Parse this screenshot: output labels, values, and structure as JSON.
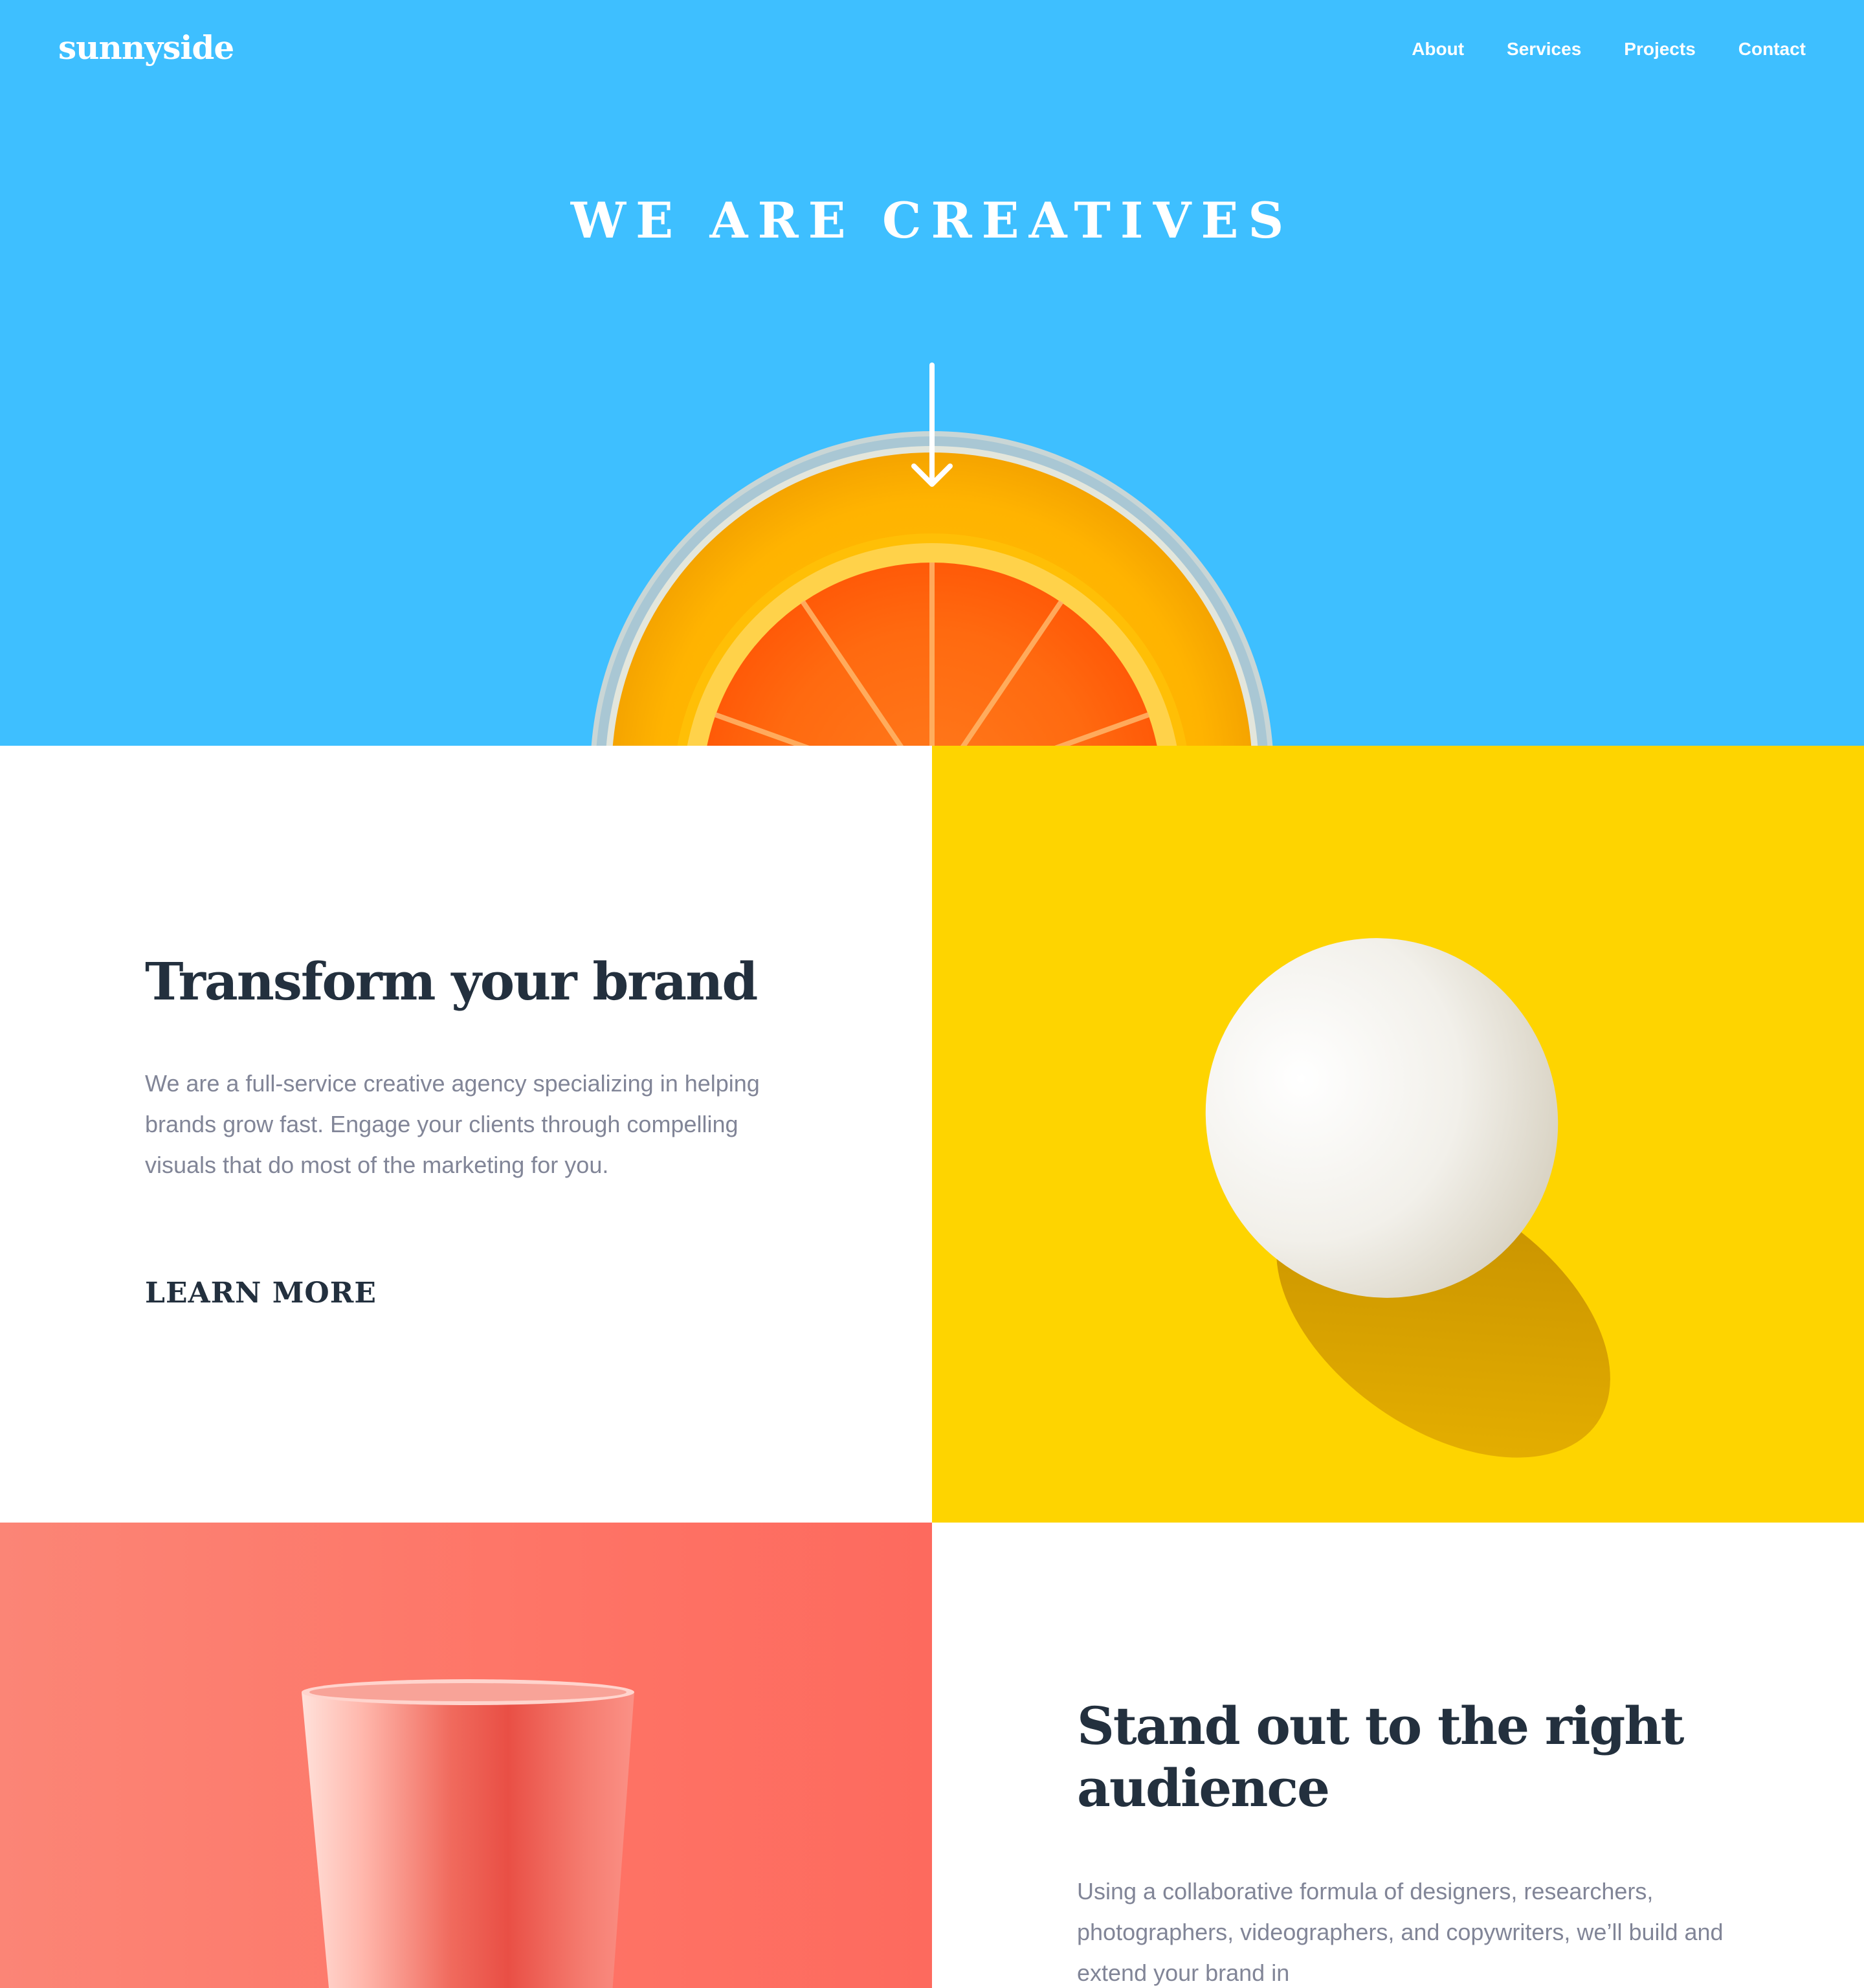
{
  "header": {
    "logo": "sunnyside",
    "nav": [
      "About",
      "Services",
      "Projects",
      "Contact"
    ]
  },
  "hero": {
    "title": "WE ARE CREATIVES",
    "arrow_icon": "arrow-down-icon"
  },
  "sections": [
    {
      "heading": "Transform your brand",
      "body": "We are a full-service creative agency specializing in helping brands grow fast. Engage your clients through compelling visuals that do most of the marketing for you.",
      "link": "LEARN MORE"
    },
    {
      "heading": "Stand out to the right audience",
      "body": "Using a collaborative formula of designers, researchers, photographers, videographers, and copywriters, we’ll build and extend your brand in"
    }
  ],
  "colors": {
    "hero_bg": "#3ebfff",
    "egg_bg": "#fed400",
    "cup_bg": "#fe7466",
    "heading": "#23303e",
    "body": "#818597"
  }
}
